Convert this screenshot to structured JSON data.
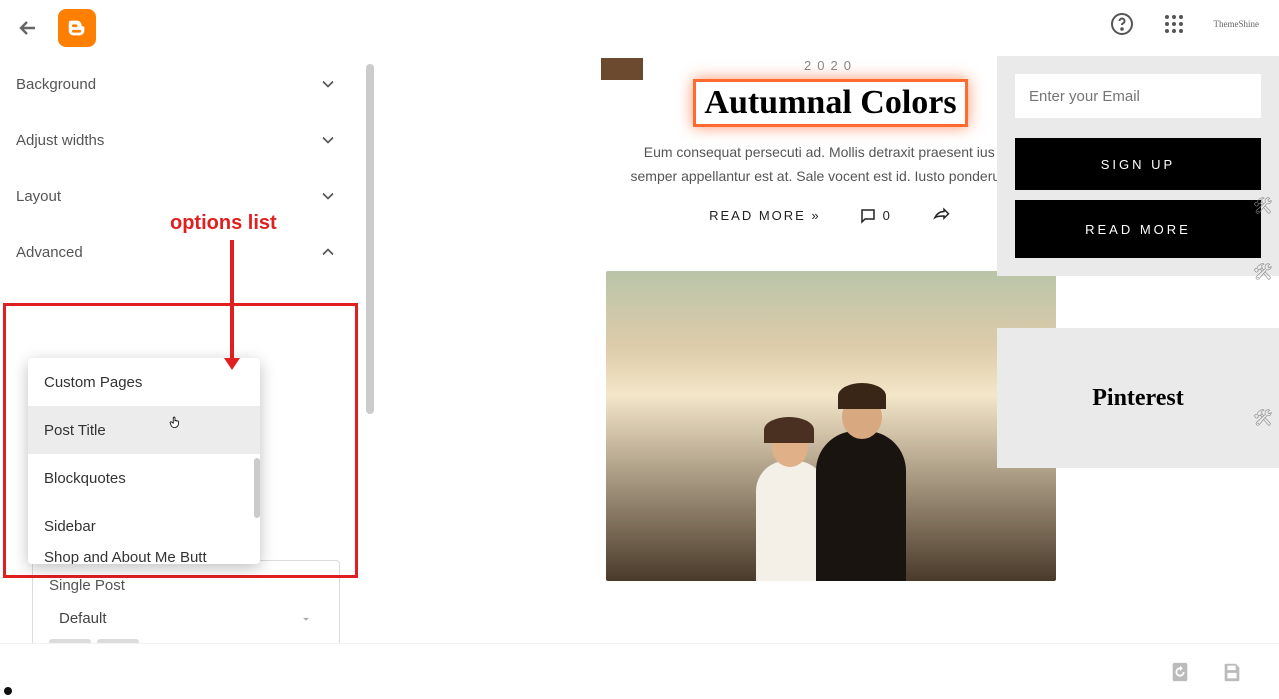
{
  "topbar": {
    "theme_label": "ThemeShine"
  },
  "sidebar": {
    "background": "Background",
    "adjust_widths": "Adjust widths",
    "layout": "Layout",
    "advanced": "Advanced",
    "options": [
      "Custom Pages",
      "Post Title",
      "Blockquotes",
      "Sidebar",
      "Shop and About Me Butt"
    ],
    "single_post": {
      "label": "Single Post",
      "value": "Default"
    }
  },
  "annotation": {
    "label": "options list"
  },
  "post": {
    "year": "2020",
    "title": "Autumnal Colors",
    "excerpt": "Eum consequat persecuti ad. Mollis detraxit praesent ius cu, semper appellantur est at. Sale vocent est id. Iusto ponderum l...",
    "read_more": "READ MORE »",
    "comments": "0"
  },
  "right": {
    "email_placeholder": "Enter your Email",
    "signup": "SIGN UP",
    "readmore": "READ MORE",
    "pinterest": "Pinterest"
  }
}
